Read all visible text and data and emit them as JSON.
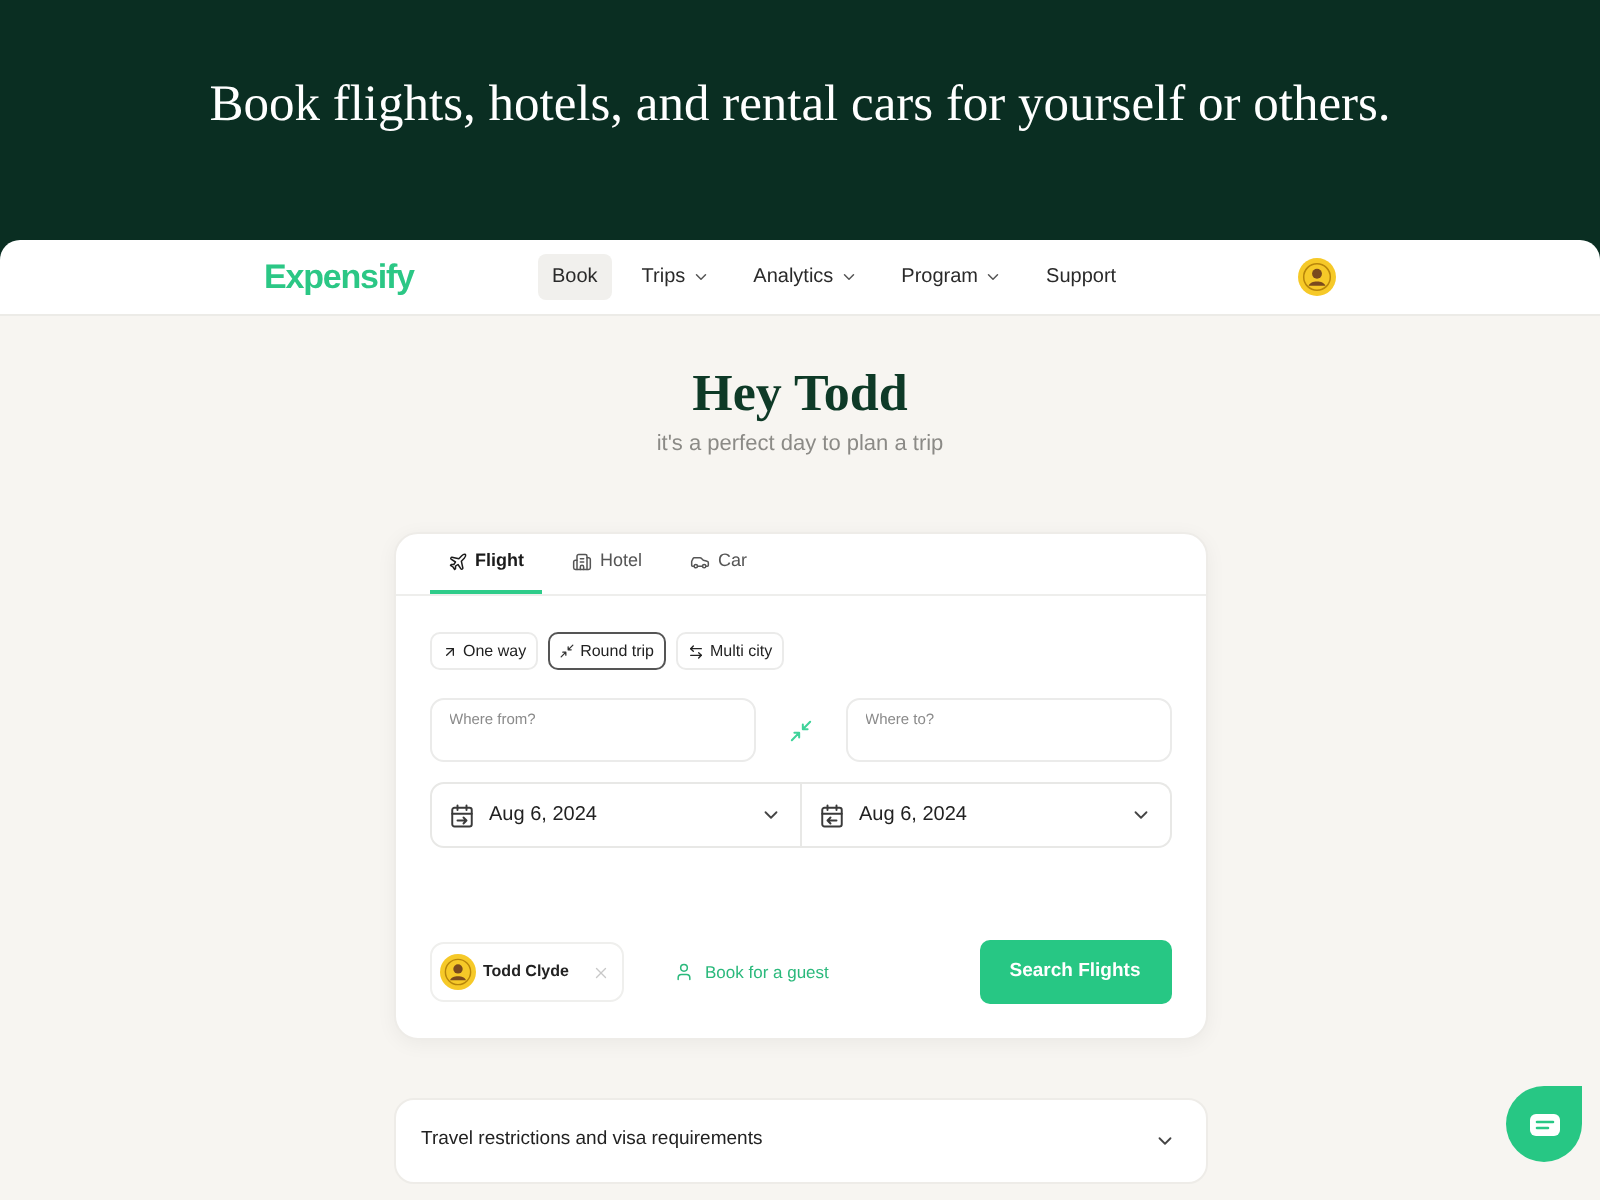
{
  "banner": {
    "heading": "Book flights, hotels, and rental cars for yourself or others."
  },
  "nav": {
    "logo": "Expensify",
    "items": [
      {
        "label": "Book",
        "selected": true,
        "has_menu": false
      },
      {
        "label": "Trips",
        "selected": false,
        "has_menu": true
      },
      {
        "label": "Analytics",
        "selected": false,
        "has_menu": true
      },
      {
        "label": "Program",
        "selected": false,
        "has_menu": true
      },
      {
        "label": "Support",
        "selected": false,
        "has_menu": false
      }
    ]
  },
  "greeting": {
    "title": "Hey Todd",
    "subtitle": "it's a perfect day to plan a trip"
  },
  "booking": {
    "tabs": [
      {
        "label": "Flight",
        "kind": "plane",
        "selected": true
      },
      {
        "label": "Hotel",
        "kind": "building",
        "selected": false
      },
      {
        "label": "Car",
        "kind": "car",
        "selected": false
      }
    ],
    "trip_types": [
      {
        "label": "One way",
        "kind": "one-way",
        "selected": false
      },
      {
        "label": "Round trip",
        "kind": "round-trip",
        "selected": true
      },
      {
        "label": "Multi city",
        "kind": "multi-city",
        "selected": false
      }
    ],
    "origin": {
      "placeholder": "Where from?"
    },
    "destination": {
      "placeholder": "Where to?"
    },
    "dates": [
      {
        "value": "Aug 6, 2024",
        "kind": "depart"
      },
      {
        "value": "Aug 6, 2024",
        "kind": "return"
      }
    ],
    "traveler": {
      "name": "Todd Clyde",
      "removable": true
    },
    "guest_link": "Book for a guest",
    "search_button": "Search Flights"
  },
  "accordion": {
    "title": "Travel restrictions and visa requirements",
    "expanded": false
  }
}
